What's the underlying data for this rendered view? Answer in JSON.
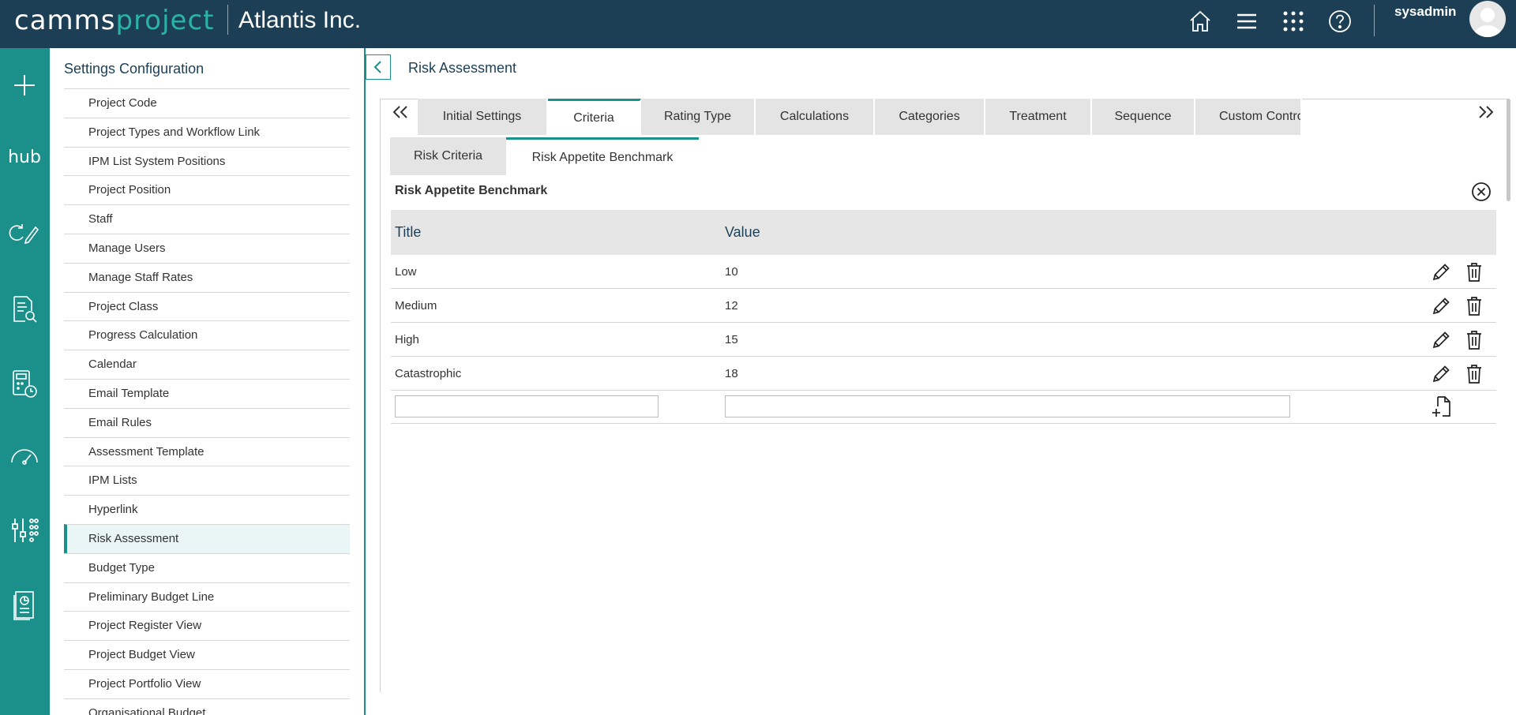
{
  "app": {
    "logo_part1": "camms",
    "logo_part2": "project",
    "org_name": "Atlantis Inc.",
    "username": "sysadmin",
    "colors": {
      "topbar": "#1c3f55",
      "accent": "#1b8f8a",
      "logo_accent": "#2bb3a6"
    }
  },
  "topnav": {
    "icons": [
      "home-icon",
      "menu-icon",
      "apps-grid-icon",
      "help-icon"
    ]
  },
  "rail": {
    "icons": [
      "add-icon",
      "hub-icon",
      "refresh-edit-icon",
      "document-search-icon",
      "calculator-clock-icon",
      "gauge-icon",
      "dashboard-icon",
      "report-icon"
    ],
    "hub_label": "hub"
  },
  "settings": {
    "title": "Settings Configuration",
    "items": [
      "Project Code",
      "Project Types and Workflow Link",
      "IPM List System Positions",
      "Project Position",
      "Staff",
      "Manage Users",
      "Manage Staff Rates",
      "Project Class",
      "Progress Calculation",
      "Calendar",
      "Email Template",
      "Email Rules",
      "Assessment Template",
      "IPM Lists",
      "Hyperlink",
      "Risk Assessment",
      "Budget Type",
      "Preliminary Budget Line",
      "Project Register View",
      "Project Budget View",
      "Project Portfolio View",
      "Organisational Budget"
    ],
    "active_item": "Risk Assessment"
  },
  "main": {
    "page_title": "Risk Assessment",
    "tabs": [
      {
        "label": "Initial Settings",
        "active": false
      },
      {
        "label": "Criteria",
        "active": true
      },
      {
        "label": "Rating Type",
        "active": false
      },
      {
        "label": "Calculations",
        "active": false
      },
      {
        "label": "Categories",
        "active": false
      },
      {
        "label": "Treatment",
        "active": false
      },
      {
        "label": "Sequence",
        "active": false
      },
      {
        "label": "Custom Contro",
        "active": false
      }
    ],
    "subtabs": [
      {
        "label": "Risk Criteria",
        "active": false
      },
      {
        "label": "Risk Appetite Benchmark",
        "active": true
      }
    ],
    "section_title": "Risk Appetite Benchmark",
    "grid": {
      "columns": [
        "Title",
        "Value"
      ],
      "rows": [
        {
          "title": "Low",
          "value": "10"
        },
        {
          "title": "Medium",
          "value": "12"
        },
        {
          "title": "High",
          "value": "15"
        },
        {
          "title": "Catastrophic",
          "value": "18"
        }
      ],
      "new_row": {
        "title_value": "",
        "value_value": ""
      }
    }
  }
}
